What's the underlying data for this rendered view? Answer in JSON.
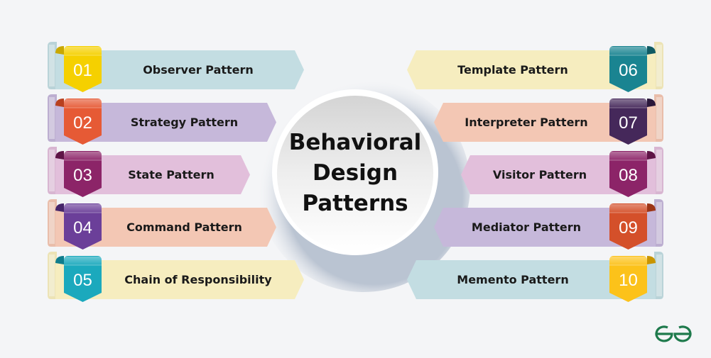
{
  "title": {
    "lines": [
      "Behavioral",
      "Design",
      "Patterns"
    ]
  },
  "left_items": [
    {
      "number": "01",
      "label": "Observer Pattern",
      "ribbon_color": "#c3dde2",
      "badge_color": "#f5d000",
      "badge_dark": "#c9a800"
    },
    {
      "number": "02",
      "label": "Strategy Pattern",
      "ribbon_color": "#c6b8da",
      "badge_color": "#e65a35",
      "badge_dark": "#b8401f"
    },
    {
      "number": "03",
      "label": "State Pattern",
      "ribbon_color": "#e2bfdb",
      "badge_color": "#8c2468",
      "badge_dark": "#5e1446"
    },
    {
      "number": "04",
      "label": "Command Pattern",
      "ribbon_color": "#f3c7b4",
      "badge_color": "#6b3f99",
      "badge_dark": "#46256a"
    },
    {
      "number": "05",
      "label": "Chain of Responsibility",
      "ribbon_color": "#f6edbf",
      "badge_color": "#1ba9bd",
      "badge_dark": "#0e7d8d"
    }
  ],
  "right_items": [
    {
      "number": "06",
      "label": "Template Pattern",
      "ribbon_color": "#f6edbf",
      "badge_color": "#1a8491",
      "badge_dark": "#0f5a63"
    },
    {
      "number": "07",
      "label": "Interpreter Pattern",
      "ribbon_color": "#f3c7b4",
      "badge_color": "#45285a",
      "badge_dark": "#2a173a"
    },
    {
      "number": "08",
      "label": "Visitor Pattern",
      "ribbon_color": "#e2bfdb",
      "badge_color": "#8c2468",
      "badge_dark": "#5e1446"
    },
    {
      "number": "09",
      "label": "Mediator Pattern",
      "ribbon_color": "#c6b8da",
      "badge_color": "#d4502a",
      "badge_dark": "#9c3516"
    },
    {
      "number": "10",
      "label": "Memento Pattern",
      "ribbon_color": "#c3dde2",
      "badge_color": "#fcc21a",
      "badge_dark": "#c99500"
    }
  ],
  "logo": {
    "icon": "geeksforgeeks-logo-icon",
    "color": "#1e7a4c"
  }
}
